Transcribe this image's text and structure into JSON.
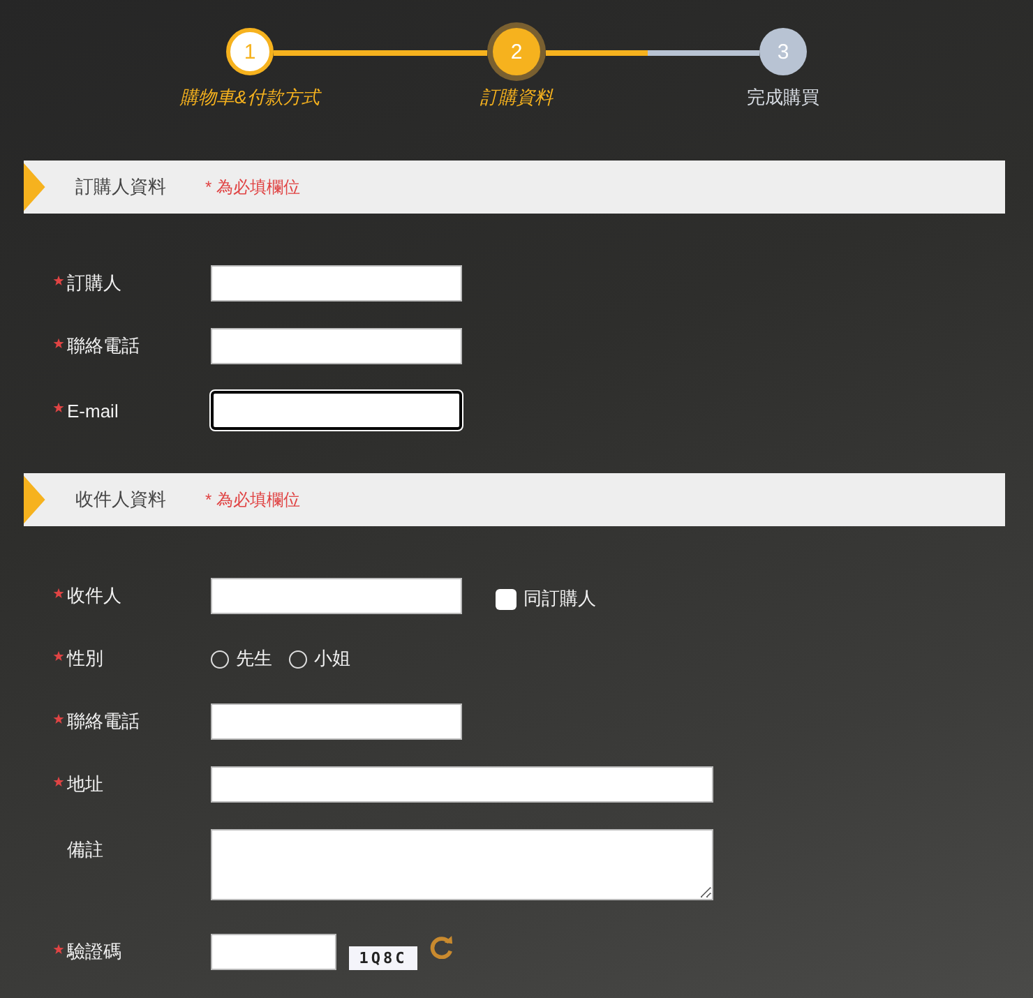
{
  "stepper": {
    "steps": [
      {
        "number": "1",
        "label": "購物車&付款方式",
        "selected": false
      },
      {
        "number": "2",
        "label": "訂購資料",
        "selected": true
      },
      {
        "number": "3",
        "label": "完成購買",
        "selected": false
      }
    ],
    "connectors": [
      {
        "level": 1
      },
      {
        "level": 0.48
      }
    ]
  },
  "sections": [
    {
      "title": "訂購人資料",
      "note": "* 為必填欄位",
      "fields": [
        {
          "kind": "text",
          "label": "訂購人",
          "required": true
        },
        {
          "kind": "text",
          "label": "聯絡電話",
          "required": true
        },
        {
          "kind": "text",
          "label": "E-mail",
          "required": true,
          "focused": true
        }
      ]
    },
    {
      "title": "收件人資料",
      "note": "* 為必填欄位",
      "fields": [
        {
          "kind": "text",
          "label": "收件人",
          "required": true,
          "checkbox": {
            "label": "同訂購人",
            "checked": false
          }
        },
        {
          "kind": "radio",
          "label": "性別",
          "required": true,
          "options": [
            {
              "label": "先生",
              "selected": false
            },
            {
              "label": "小姐",
              "selected": false
            }
          ]
        },
        {
          "kind": "text",
          "label": "聯絡電話",
          "required": true
        },
        {
          "kind": "wide-text",
          "label": "地址",
          "required": true
        },
        {
          "kind": "textarea",
          "label": "備註",
          "required": false
        },
        {
          "kind": "captcha",
          "label": "驗證碼",
          "required": true,
          "code": "1Q8C"
        }
      ]
    }
  ]
}
